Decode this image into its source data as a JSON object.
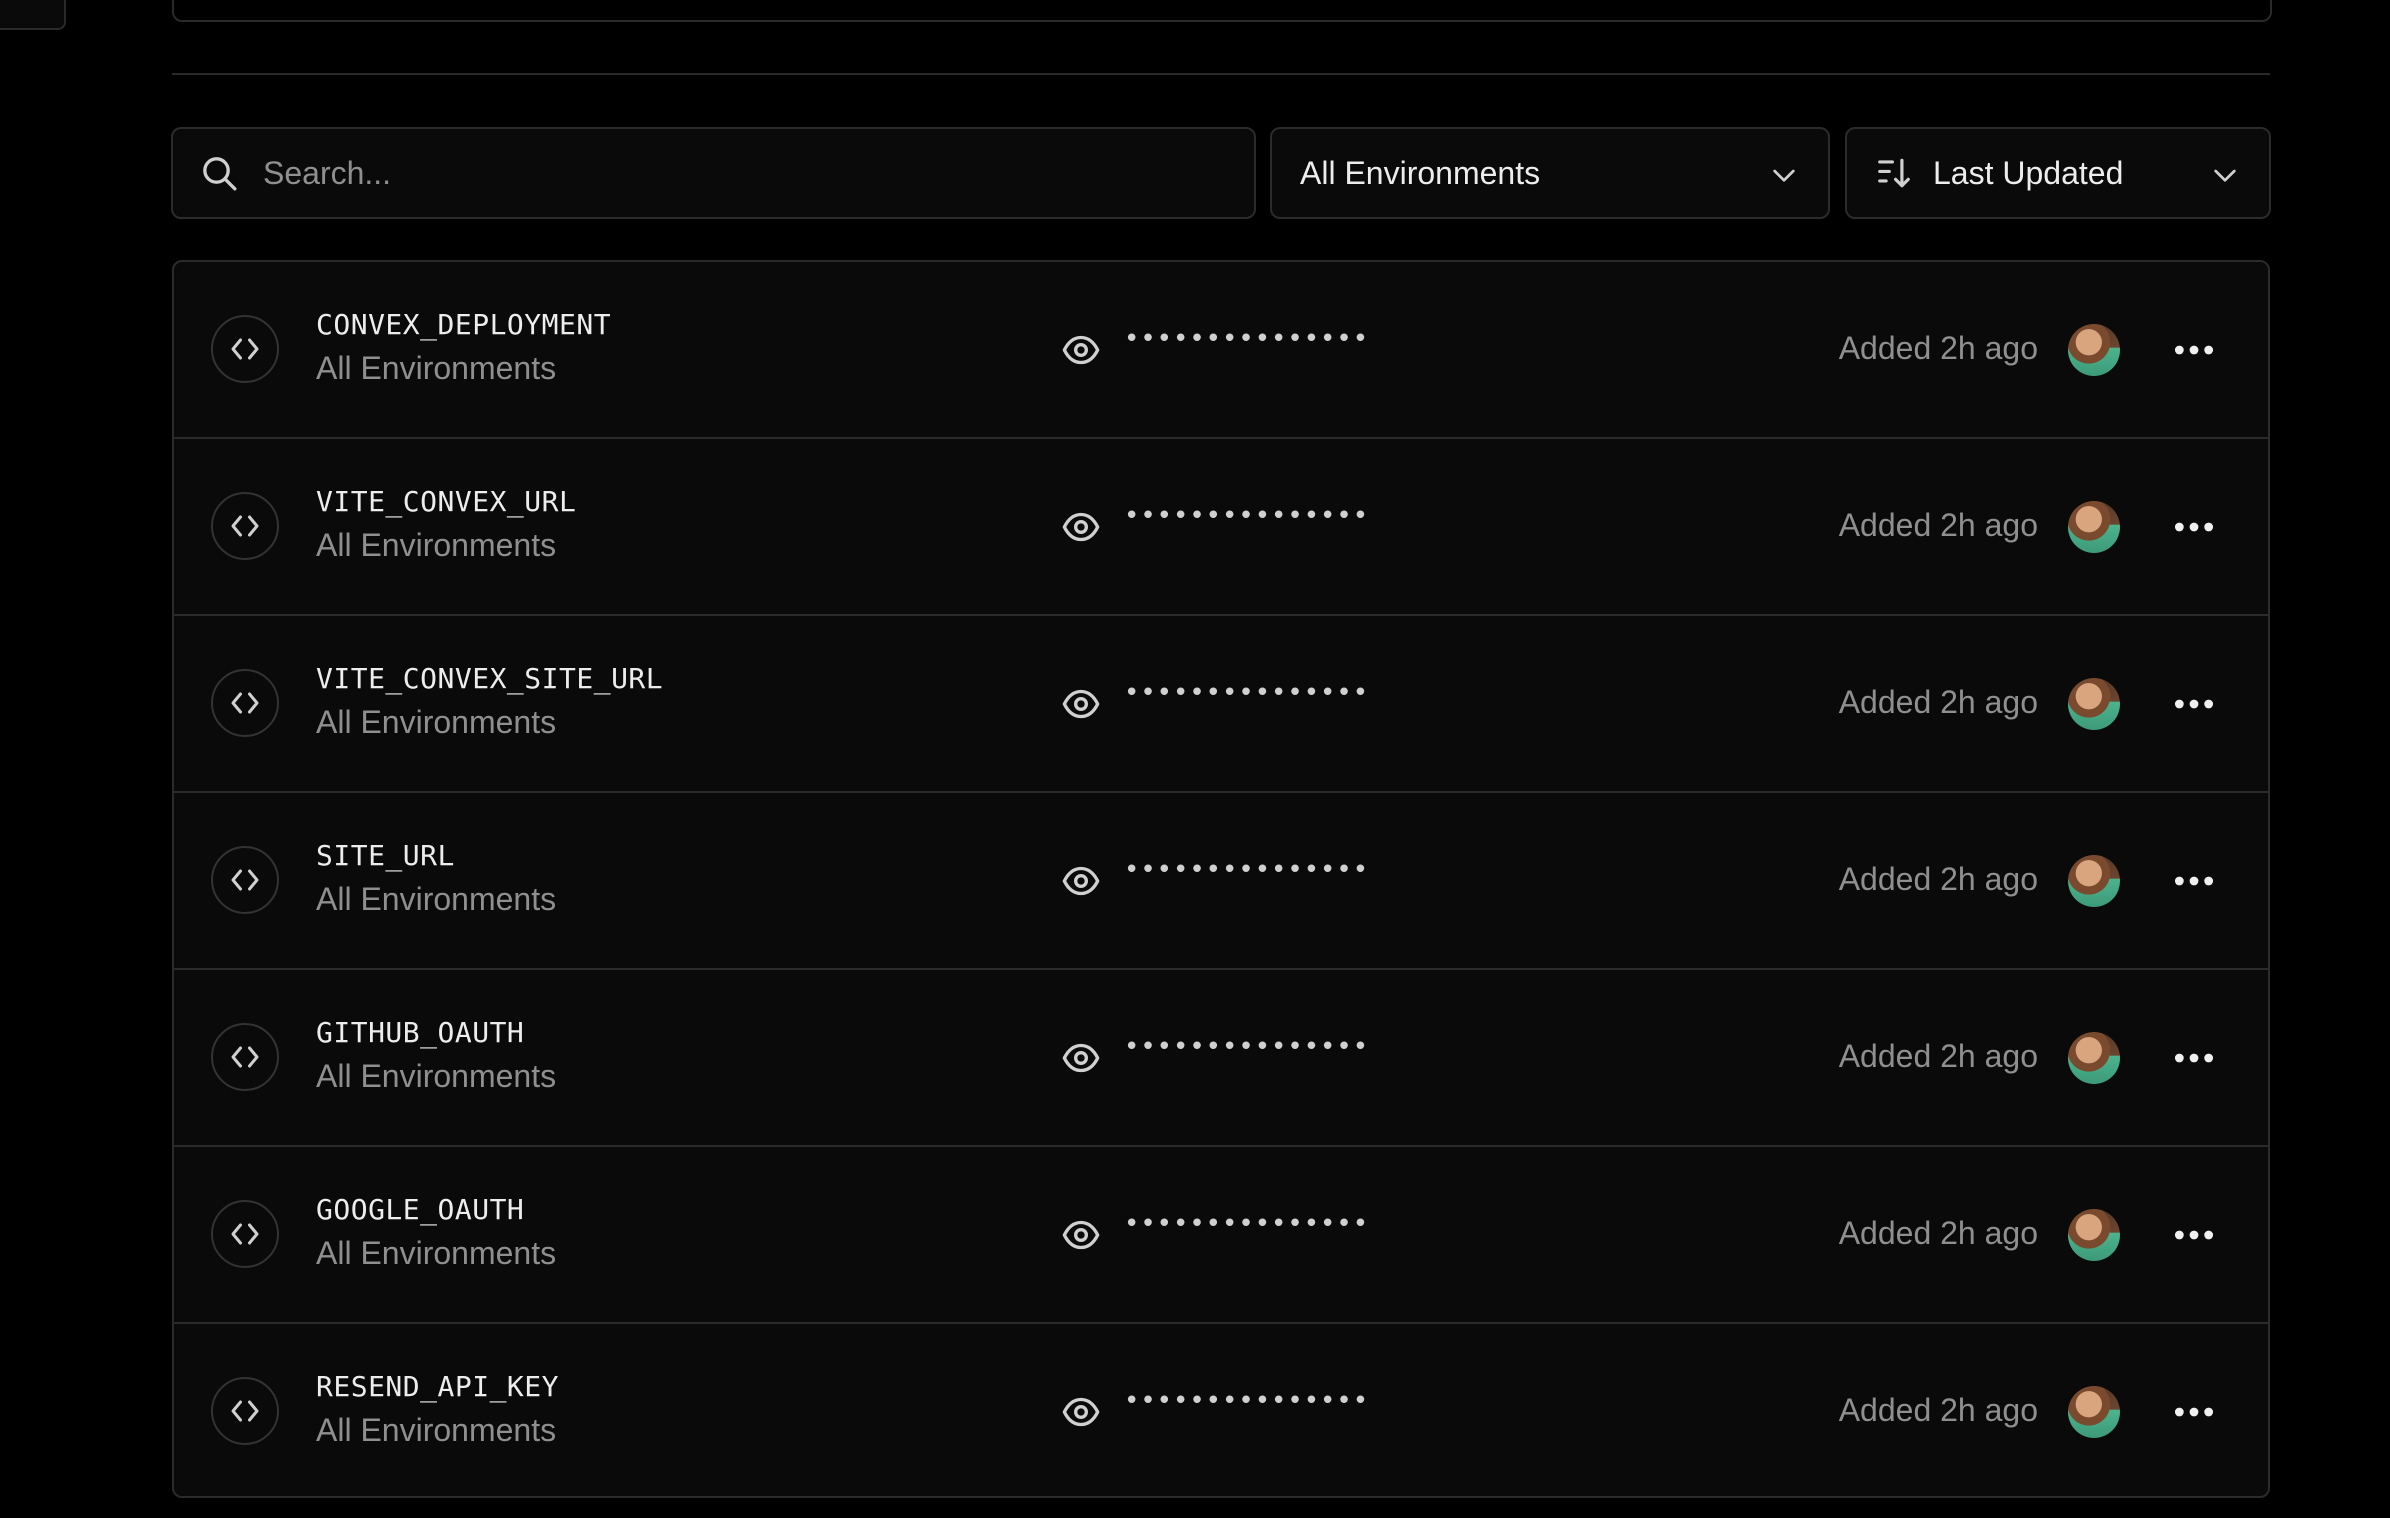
{
  "toolbar": {
    "search_placeholder": "Search...",
    "environment_filter": "All Environments",
    "sort": "Last Updated"
  },
  "variables": [
    {
      "name": "CONVEX_DEPLOYMENT",
      "environment": "All Environments",
      "value_masked": "•••••••••••••••",
      "added": "Added 2h ago"
    },
    {
      "name": "VITE_CONVEX_URL",
      "environment": "All Environments",
      "value_masked": "•••••••••••••••",
      "added": "Added 2h ago"
    },
    {
      "name": "VITE_CONVEX_SITE_URL",
      "environment": "All Environments",
      "value_masked": "•••••••••••••••",
      "added": "Added 2h ago"
    },
    {
      "name": "SITE_URL",
      "environment": "All Environments",
      "value_masked": "•••••••••••••••",
      "added": "Added 2h ago"
    },
    {
      "name": "GITHUB_OAUTH",
      "environment": "All Environments",
      "value_masked": "•••••••••••••••",
      "added": "Added 2h ago"
    },
    {
      "name": "GOOGLE_OAUTH",
      "environment": "All Environments",
      "value_masked": "•••••••••••••••",
      "added": "Added 2h ago"
    },
    {
      "name": "RESEND_API_KEY",
      "environment": "All Environments",
      "value_masked": "•••••••••••••••",
      "added": "Added 2h ago"
    }
  ],
  "icons": {
    "search": "search-icon",
    "chevron": "chevron-down-icon",
    "sort": "sort-icon",
    "code": "code-icon",
    "eye": "eye-icon",
    "more": "more-horizontal-icon"
  },
  "colors": {
    "background": "#000000",
    "surface": "#0a0a0a",
    "border": "#2b2b2b",
    "text": "#ededed",
    "muted": "#8f8f8f"
  }
}
